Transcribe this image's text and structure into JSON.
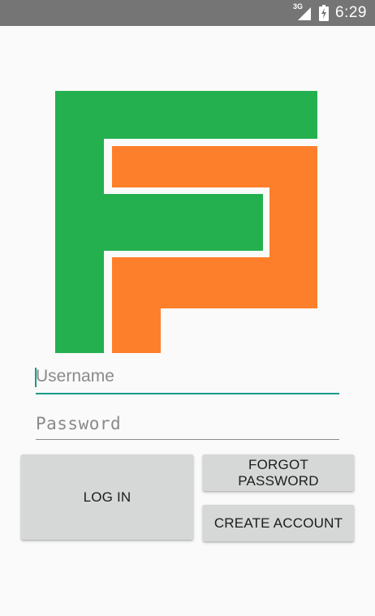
{
  "status_bar": {
    "network_type": "3G",
    "time": "6:29",
    "icons": [
      "signal-icon",
      "battery-charging-icon"
    ]
  },
  "logo": {
    "colors": {
      "green": "#24b04f",
      "orange": "#fe7f2b"
    }
  },
  "username": {
    "placeholder": "Username",
    "value": ""
  },
  "password": {
    "placeholder": "Password",
    "value": ""
  },
  "buttons": {
    "login": "LOG IN",
    "forgot_password": "FORGOT PASSWORD",
    "create_account": "CREATE ACCOUNT"
  },
  "colors": {
    "status_bar": "#757575",
    "background": "#fafafa",
    "accent": "#1a9a8a",
    "button": "#d6d7d7"
  }
}
